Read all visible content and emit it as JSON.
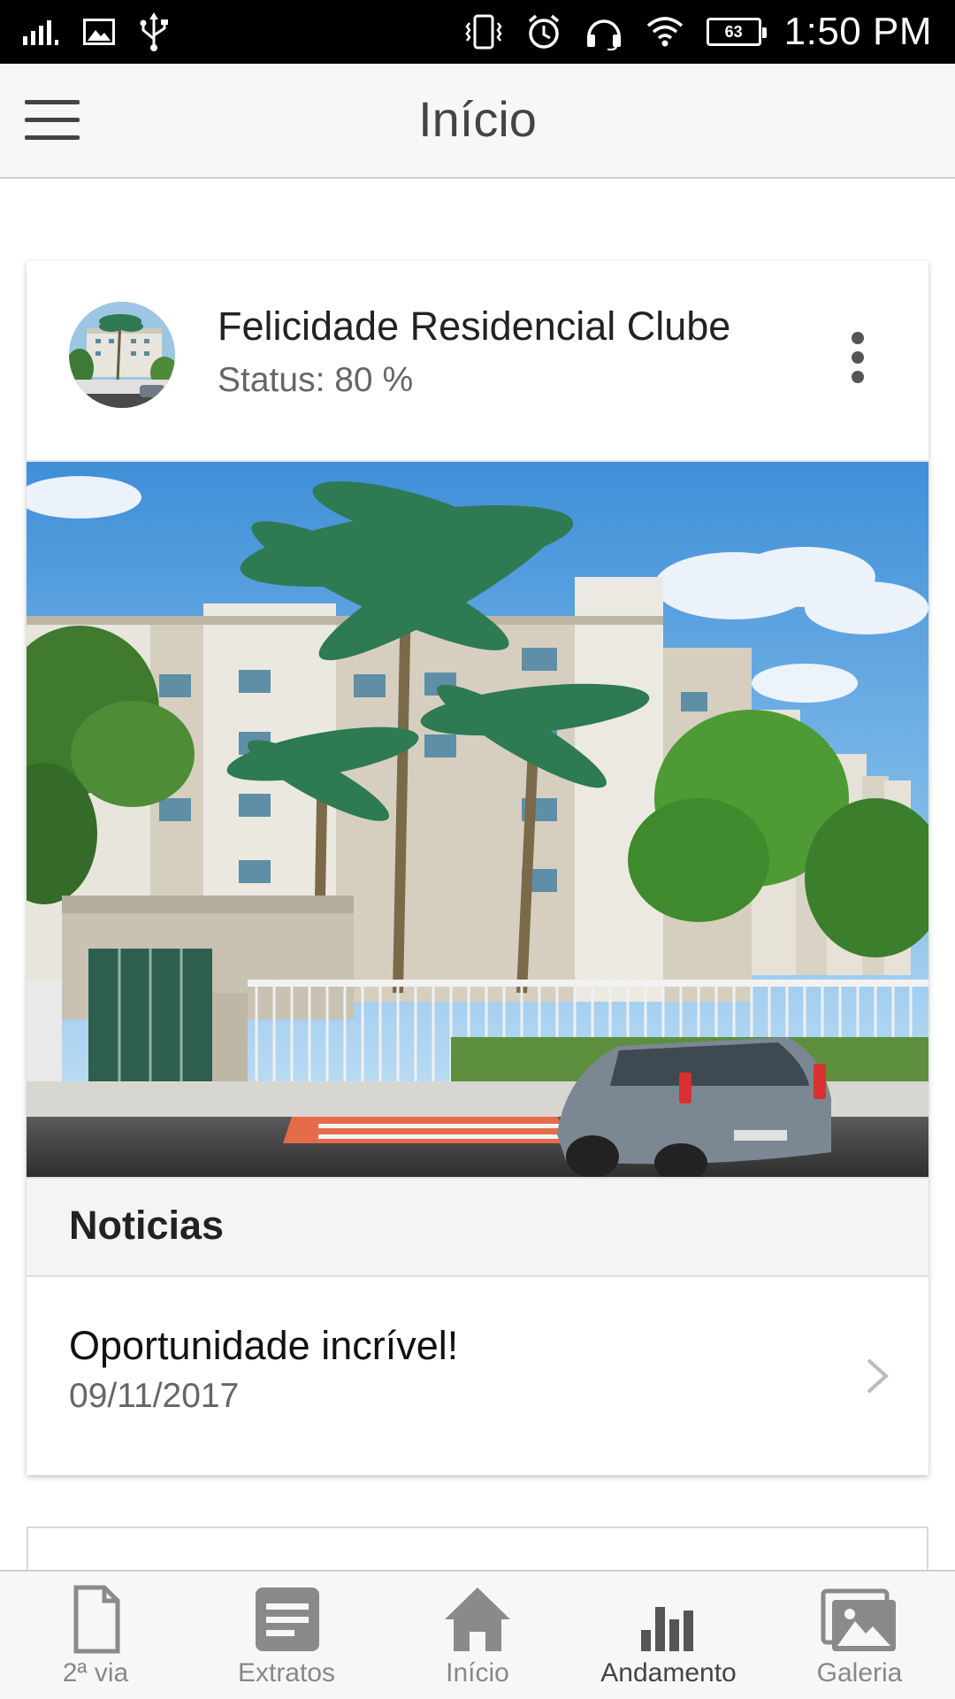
{
  "status_bar": {
    "time": "1:50 PM",
    "battery": "63",
    "icons": [
      "signal-icon",
      "image-icon",
      "usb-icon",
      "vibrate-icon",
      "alarm-icon",
      "headset-icon",
      "wifi-icon",
      "battery-icon"
    ]
  },
  "app_bar": {
    "title": "Início",
    "menu_icon": "hamburger-menu-icon"
  },
  "card": {
    "title": "Felicidade Residencial Clube",
    "status": "Status: 80 %",
    "progress_percent": 80,
    "more_icon": "more-vertical-icon"
  },
  "news": {
    "section_title": "Noticias",
    "items": [
      {
        "title": "Oportunidade incrível!",
        "date": "09/11/2017"
      }
    ]
  },
  "bottom_nav": {
    "items": [
      {
        "label": "2ª via",
        "icon": "document-icon"
      },
      {
        "label": "Extratos",
        "icon": "list-icon"
      },
      {
        "label": "Início",
        "icon": "home-icon"
      },
      {
        "label": "Andamento",
        "icon": "bar-chart-icon",
        "active": true
      },
      {
        "label": "Galeria",
        "icon": "gallery-icon"
      }
    ],
    "icon_color": "#8a8a8a",
    "active_color": "#444444"
  }
}
